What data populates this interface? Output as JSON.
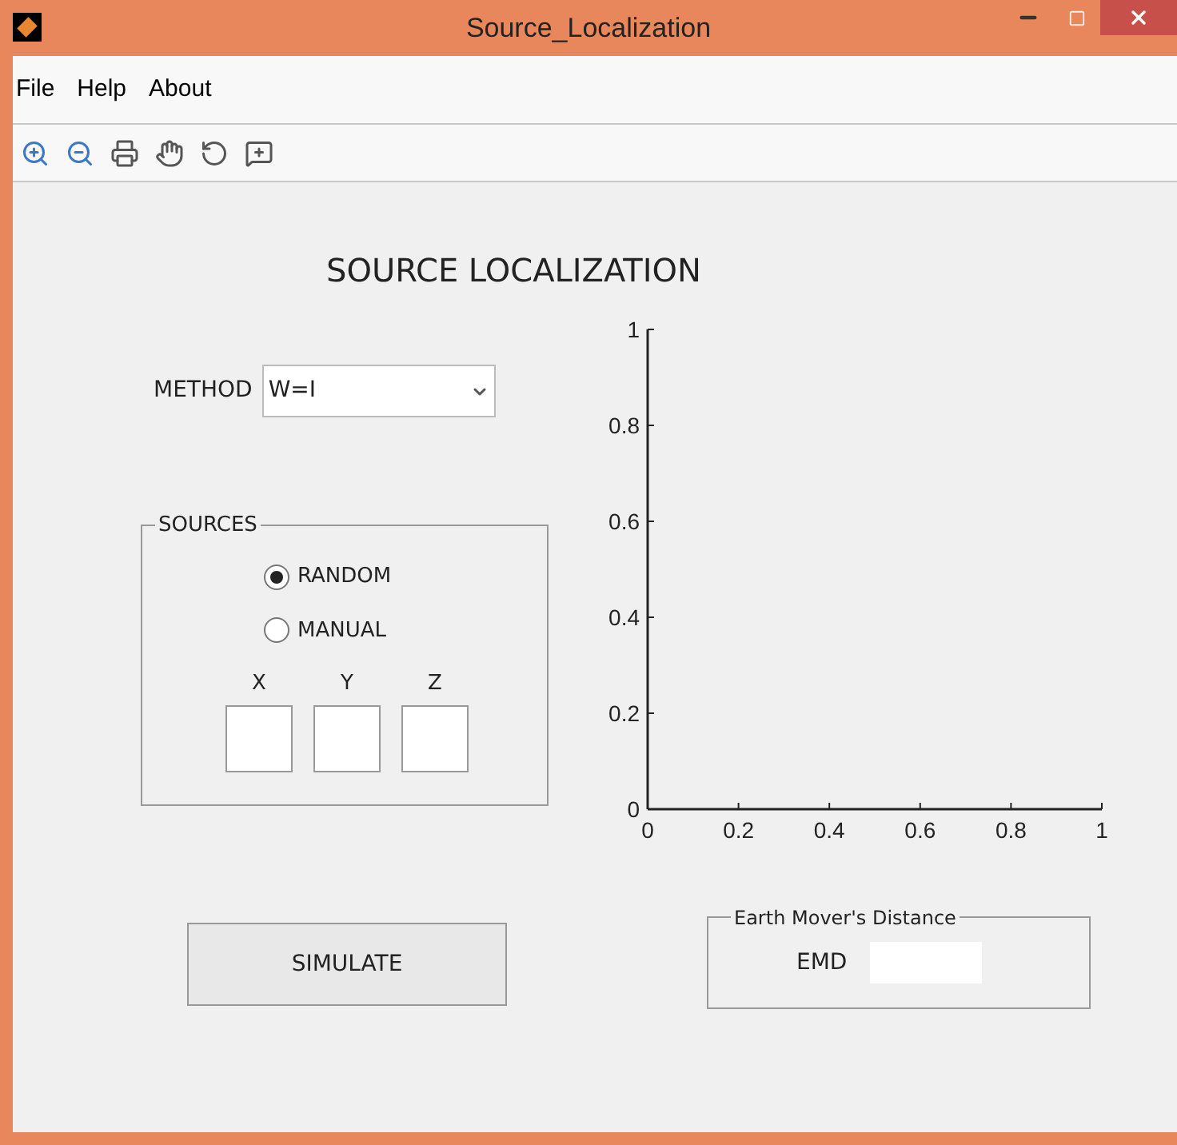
{
  "window": {
    "title": "Source_Localization"
  },
  "menu": [
    "File",
    "Help",
    "About"
  ],
  "heading": "SOURCE LOCALIZATION",
  "method": {
    "label": "METHOD",
    "value": "W=I"
  },
  "sources": {
    "title": "SOURCES",
    "options": [
      {
        "label": "RANDOM",
        "selected": true
      },
      {
        "label": "MANUAL",
        "selected": false
      }
    ],
    "coords": [
      "X",
      "Y",
      "Z"
    ]
  },
  "simulate_button": "SIMULATE",
  "plot": {
    "chart_data": {
      "type": "line",
      "xlim": [
        0,
        1
      ],
      "ylim": [
        0,
        1
      ],
      "xticks": [
        0,
        0.2,
        0.4,
        0.6,
        0.8,
        1
      ],
      "yticks": [
        0,
        0.2,
        0.4,
        0.6,
        0.8,
        1
      ]
    }
  },
  "emd": {
    "title": "Earth Mover's Distance",
    "label": "EMD"
  }
}
